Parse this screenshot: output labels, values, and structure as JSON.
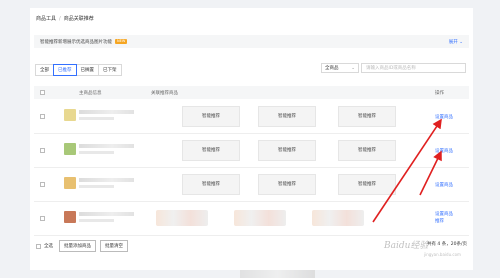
{
  "breadcrumb": {
    "parent": "商品工具",
    "current": "商品关联推荐"
  },
  "notice": {
    "text": "智能推荐新增展示优选商品图片功能",
    "badge": "NEW",
    "expand": "展开"
  },
  "tabs": [
    "全部",
    "已推荐",
    "已搁置",
    "已下架"
  ],
  "search": {
    "select_value": "全商品",
    "placeholder": "请输入商品ID或商品名称"
  },
  "table": {
    "headers": {
      "main": "主商品信息",
      "rec": "关联推荐商品",
      "op": "操作"
    },
    "smart_label": "智能推荐",
    "op_set": "设置商品",
    "op_extra": "推荐",
    "thumb_colors": [
      "#e8d890",
      "#a8c878",
      "#e8c070",
      "#c87858"
    ]
  },
  "footer": {
    "select_all": "全选",
    "batch_add": "批量添加商品",
    "batch_clear": "批量清空"
  },
  "pager": "共有 4 条，20条/页",
  "watermark": {
    "main": "Baidu经验",
    "sub": "jingyan.baidu.com"
  },
  "colors": {
    "accent": "#3370ff",
    "arrow": "#e02020",
    "badge": "#f5a623"
  }
}
